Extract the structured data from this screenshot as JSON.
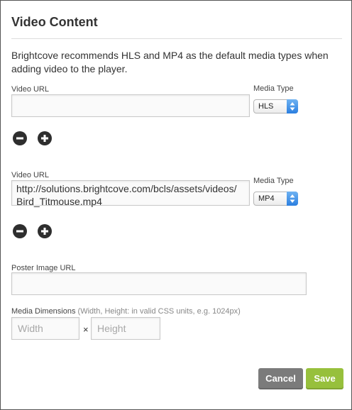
{
  "panel": {
    "title": "Video Content",
    "intro": "Brightcove recommends HLS and MP4 as the default media types when adding video to the player."
  },
  "sources": [
    {
      "url_label": "Video URL",
      "url_value": "",
      "media_label": "Media Type",
      "media_type": "HLS"
    },
    {
      "url_label": "Video URL",
      "url_value": "http://solutions.brightcove.com/bcls/assets/videos/\nBird_Titmouse.mp4",
      "media_label": "Media Type",
      "media_type": "MP4"
    }
  ],
  "icons": {
    "remove": "minus-circle-icon",
    "add": "plus-circle-icon",
    "select_arrows": "up-down-arrows-icon"
  },
  "poster": {
    "label": "Poster Image URL",
    "value": ""
  },
  "dimensions": {
    "label": "Media Dimensions",
    "hint": "(Width, Height: in valid CSS units, e.g. 1024px)",
    "width_placeholder": "Width",
    "separator": "×",
    "height_placeholder": "Height"
  },
  "actions": {
    "cancel": "Cancel",
    "save": "Save"
  },
  "colors": {
    "save": "#97c03c",
    "cancel": "#7b7b7b",
    "select_accent": "#2a7ee0"
  }
}
